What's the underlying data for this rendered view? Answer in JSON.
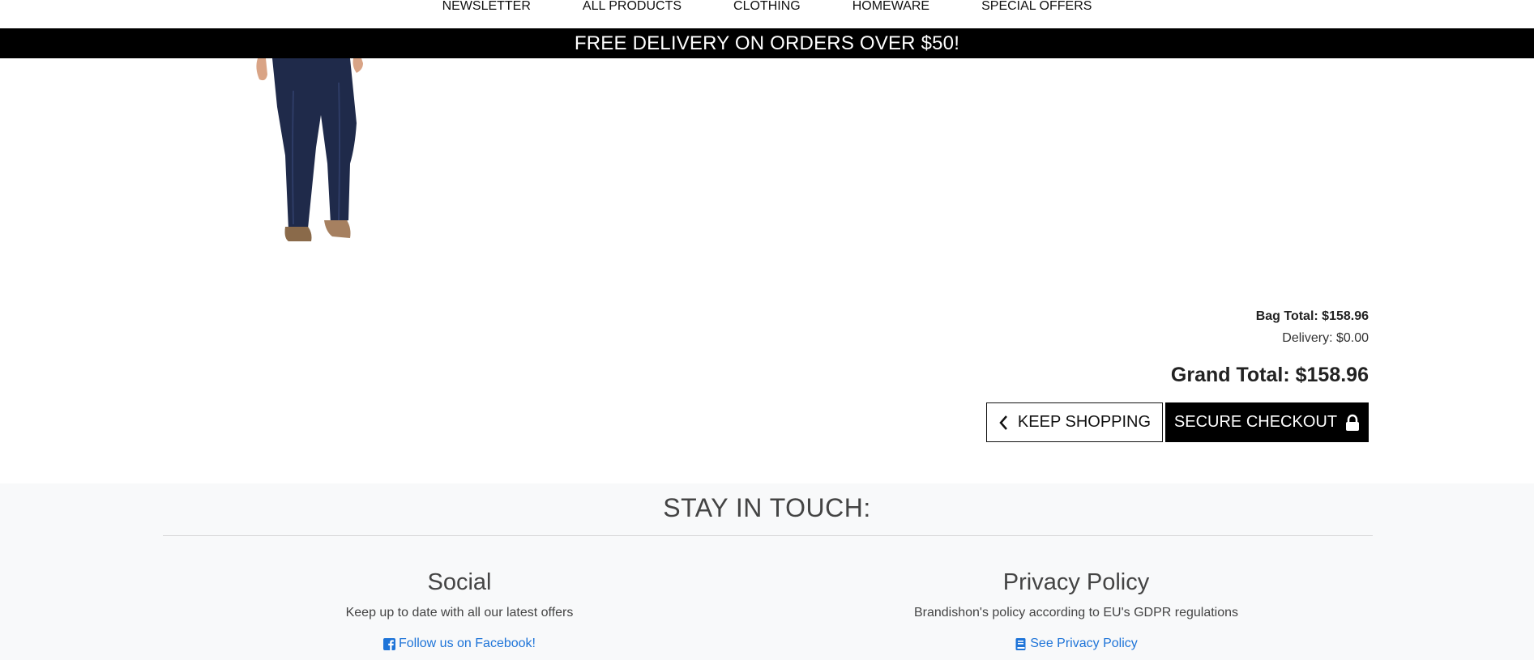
{
  "nav": {
    "items": [
      {
        "label": "NEWSLETTER"
      },
      {
        "label": "ALL PRODUCTS"
      },
      {
        "label": "CLOTHING"
      },
      {
        "label": "HOMEWARE"
      },
      {
        "label": "SPECIAL OFFERS"
      }
    ]
  },
  "banner": {
    "text": "FREE DELIVERY ON ORDERS OVER $50!"
  },
  "summary": {
    "bag_total": "Bag Total: $158.96",
    "delivery": "Delivery: $0.00",
    "grand_total": "Grand Total: $158.96"
  },
  "buttons": {
    "keep_shopping": "KEEP SHOPPING",
    "secure_checkout": "SECURE CHECKOUT"
  },
  "footer": {
    "title": "STAY IN TOUCH:",
    "social": {
      "heading": "Social",
      "description": "Keep up to date with all our latest offers",
      "link": "Follow us on Facebook!",
      "icon": "facebook-icon"
    },
    "privacy": {
      "heading": "Privacy Policy",
      "description": "Brandishon's policy according to EU's GDPR regulations",
      "link": "See Privacy Policy",
      "icon": "book-icon"
    }
  },
  "colors": {
    "banner_bg": "#000000",
    "footer_bg": "#f8f9fa",
    "link": "#1e74d8"
  }
}
